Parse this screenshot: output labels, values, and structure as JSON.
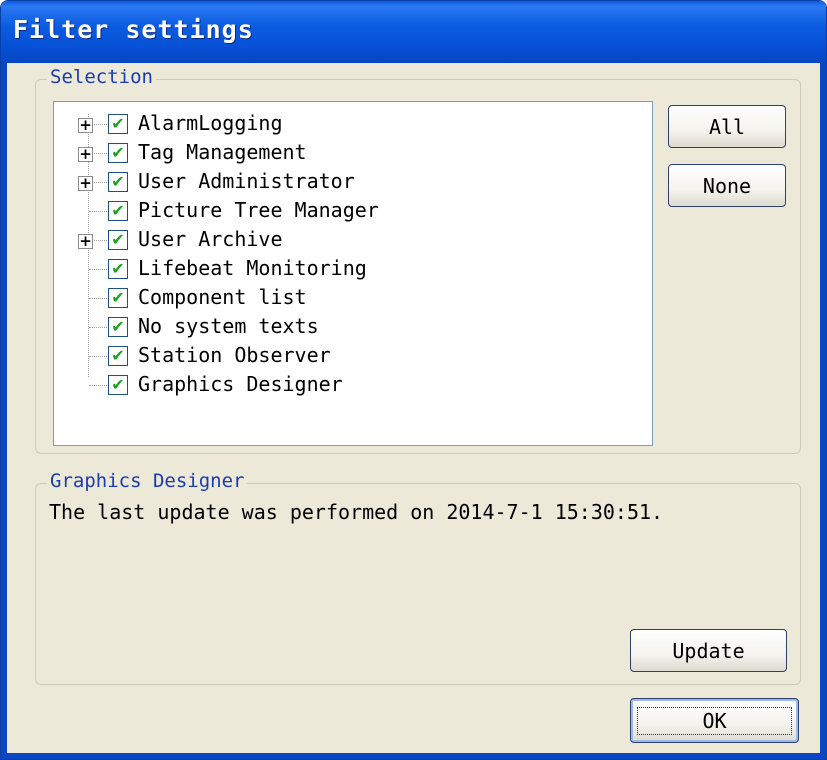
{
  "window": {
    "title": "Filter settings"
  },
  "selection": {
    "label": "Selection",
    "items": [
      {
        "label": "AlarmLogging",
        "expandable": true,
        "checked": true
      },
      {
        "label": "Tag Management",
        "expandable": true,
        "checked": true
      },
      {
        "label": "User Administrator",
        "expandable": true,
        "checked": true
      },
      {
        "label": "Picture Tree Manager",
        "expandable": false,
        "checked": true
      },
      {
        "label": "User Archive",
        "expandable": true,
        "checked": true
      },
      {
        "label": "Lifebeat Monitoring",
        "expandable": false,
        "checked": true
      },
      {
        "label": "Component list",
        "expandable": false,
        "checked": true
      },
      {
        "label": "No system texts",
        "expandable": false,
        "checked": true
      },
      {
        "label": "Station Observer",
        "expandable": false,
        "checked": true
      },
      {
        "label": "Graphics Designer",
        "expandable": false,
        "checked": true
      }
    ],
    "all_label": "All",
    "none_label": "None"
  },
  "detail": {
    "label": "Graphics Designer",
    "status": "The last update was performed on 2014-7-1 15:30:51.",
    "update_label": "Update"
  },
  "footer": {
    "ok_label": "OK"
  },
  "colors": {
    "titlebar": "#0b5ce1",
    "group_label": "#1c3bb0",
    "check": "#21a121",
    "face": "#ece9d8"
  }
}
